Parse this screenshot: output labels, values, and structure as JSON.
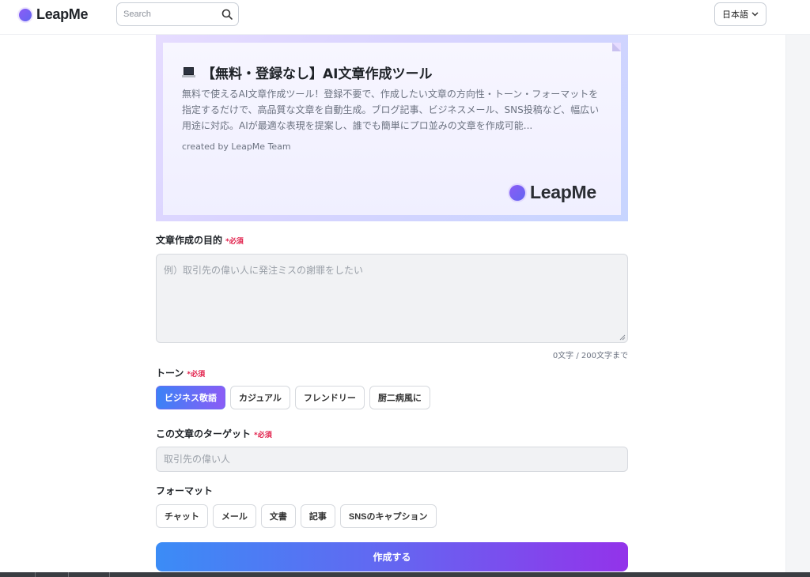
{
  "header": {
    "logo_text": "LeapMe",
    "search_placeholder": "Search",
    "language_label": "日本語"
  },
  "hero": {
    "title": "【無料・登録なし】AI文章作成ツール",
    "description": "無料で使えるAI文章作成ツール！登録不要で、作成したい文章の方向性・トーン・フォーマットを指定するだけで、高品質な文章を自動生成。ブログ記事、ビジネスメール、SNS投稿など、幅広い用途に対応。AIが最適な表現を提案し、誰でも簡単にプロ並みの文章を作成可能...",
    "author": "created by LeapMe Team",
    "brand": "LeapMe"
  },
  "form": {
    "purpose": {
      "label": "文章作成の目的",
      "required": "*必須",
      "placeholder": "例）取引先の偉い人に発注ミスの謝罪をしたい",
      "counter": "0文字 / 200文字まで"
    },
    "tone": {
      "label": "トーン",
      "required": "*必須",
      "options": [
        "ビジネス敬語",
        "カジュアル",
        "フレンドリー",
        "厨二病風に"
      ],
      "selected": "ビジネス敬語"
    },
    "target": {
      "label": "この文章のターゲット",
      "required": "*必須",
      "placeholder": "取引先の偉い人"
    },
    "format": {
      "label": "フォーマット",
      "options": [
        "チャット",
        "メール",
        "文書",
        "記事",
        "SNSのキャプション"
      ]
    },
    "submit_label": "作成する"
  },
  "colors": {
    "accent_start": "#3b82f6",
    "accent_end": "#9333ea",
    "required": "#e11d48"
  }
}
